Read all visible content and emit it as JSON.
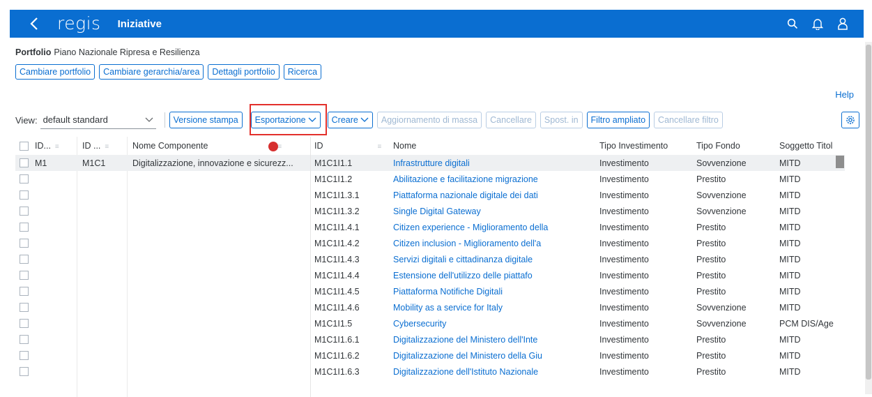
{
  "shell": {
    "logo": "regis",
    "title": "Iniziative"
  },
  "header": {
    "portfolio_label": "Portfolio",
    "portfolio_value": "Piano Nazionale Ripresa e Resilienza",
    "buttons": [
      "Cambiare portfolio",
      "Cambiare gerarchia/area",
      "Dettagli portfolio",
      "Ricerca"
    ]
  },
  "help": "Help",
  "toolbar": {
    "view_label": "View:",
    "view_value": "default standard",
    "versione_stampa": "Versione stampa",
    "esportazione": "Esportazione",
    "creare": "Creare",
    "aggiornamento": "Aggiornamento di massa",
    "cancellare": "Cancellare",
    "spost": "Spost. in",
    "filtro": "Filtro ampliato",
    "cancellare_filtro": "Cancellare filtro"
  },
  "left_table": {
    "headers": [
      "ID...",
      "ID ...",
      "Nome Componente"
    ],
    "rows": [
      [
        "M1",
        "M1C1",
        "Digitalizzazione, innovazione e sicurezz..."
      ]
    ]
  },
  "right_table": {
    "headers": [
      "ID",
      "Nome",
      "Tipo Investimento",
      "Tipo Fondo",
      "Soggetto Titol"
    ],
    "rows": [
      [
        "M1C1I1.1",
        "Infrastrutture digitali",
        "Investimento",
        "Sovvenzione",
        "MITD"
      ],
      [
        "M1C1I1.2",
        "Abilitazione e facilitazione migrazione",
        "Investimento",
        "Prestito",
        "MITD"
      ],
      [
        "M1C1I1.3.1",
        "Piattaforma nazionale digitale dei dati",
        "Investimento",
        "Sovvenzione",
        "MITD"
      ],
      [
        "M1C1I1.3.2",
        " Single Digital Gateway",
        "Investimento",
        "Sovvenzione",
        "MITD"
      ],
      [
        "M1C1I1.4.1",
        "Citizen experience - Miglioramento della",
        "Investimento",
        "Prestito",
        "MITD"
      ],
      [
        "M1C1I1.4.2",
        "Citizen inclusion - Miglioramento dell'a",
        "Investimento",
        "Prestito",
        "MITD"
      ],
      [
        "M1C1I1.4.3",
        "Servizi digitali e cittadinanza digitale",
        "Investimento",
        "Prestito",
        "MITD"
      ],
      [
        "M1C1I1.4.4",
        " Estensione dell'utilizzo delle piattafo",
        "Investimento",
        "Prestito",
        "MITD"
      ],
      [
        "M1C1I1.4.5",
        " Piattaforma Notifiche Digitali",
        "Investimento",
        "Prestito",
        "MITD"
      ],
      [
        "M1C1I1.4.6",
        " Mobility as a service for Italy",
        "Investimento",
        "Sovvenzione",
        "MITD"
      ],
      [
        "M1C1I1.5",
        "Cybersecurity",
        "Investimento",
        "Sovvenzione",
        "PCM DIS/Age"
      ],
      [
        "M1C1I1.6.1",
        "Digitalizzazione del Ministero dell'Inte",
        "Investimento",
        "Prestito",
        "MITD"
      ],
      [
        "M1C1I1.6.2",
        "Digitalizzazione del Ministero della Giu",
        "Investimento",
        "Prestito",
        "MITD"
      ],
      [
        "M1C1I1.6.3",
        "Digitalizzazione dell'Istituto Nazionale",
        "Investimento",
        "Prestito",
        "MITD"
      ]
    ]
  },
  "colors": {
    "brand": "#0a6ed1",
    "highlight": "#e3302b"
  }
}
